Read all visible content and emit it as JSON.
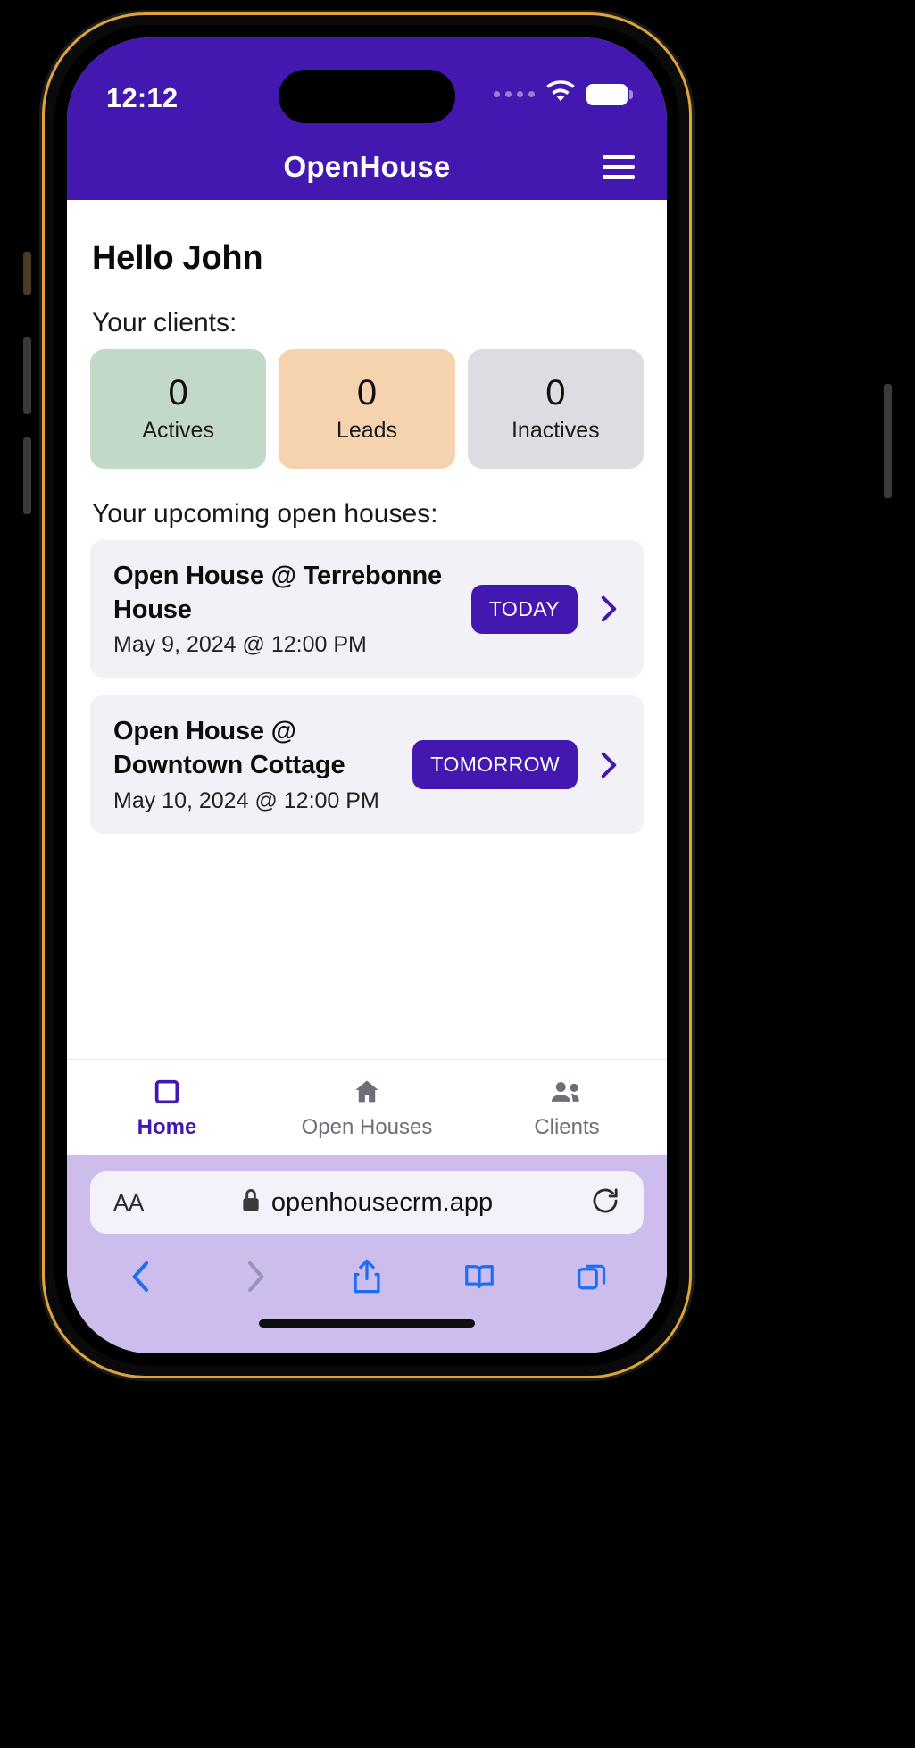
{
  "status_bar": {
    "time": "12:12",
    "signal_icon": "signal-dots-icon",
    "wifi_icon": "wifi-icon",
    "battery_icon": "battery-full-icon"
  },
  "app_header": {
    "title": "OpenHouse",
    "menu_icon": "hamburger-menu-icon"
  },
  "main": {
    "greeting": "Hello John",
    "clients_label": "Your clients:",
    "client_stats": [
      {
        "count": "0",
        "label": "Actives",
        "color": "#c1d9c6"
      },
      {
        "count": "0",
        "label": "Leads",
        "color": "#f4d3ae"
      },
      {
        "count": "0",
        "label": "Inactives",
        "color": "#dedce2"
      }
    ],
    "open_houses_label": "Your upcoming open houses:",
    "open_houses": [
      {
        "title": "Open House @ Terrebonne House",
        "date": "May 9, 2024 @ 12:00 PM",
        "badge": "TODAY",
        "chevron_icon": "chevron-right-icon"
      },
      {
        "title": "Open House @ Downtown Cottage",
        "date": "May 10, 2024 @ 12:00 PM",
        "badge": "TOMORROW",
        "chevron_icon": "chevron-right-icon"
      }
    ]
  },
  "tab_bar": [
    {
      "label": "Home",
      "icon": "square-outline-icon",
      "active": true
    },
    {
      "label": "Open Houses",
      "icon": "house-icon",
      "active": false
    },
    {
      "label": "Clients",
      "icon": "people-group-icon",
      "active": false
    }
  ],
  "browser": {
    "text_size_label": "AA",
    "lock_icon": "lock-icon",
    "url": "openhousecrm.app",
    "reload_icon": "reload-icon",
    "toolbar": [
      {
        "name": "back-button",
        "icon": "chevron-left-icon",
        "enabled": true
      },
      {
        "name": "forward-button",
        "icon": "chevron-right-icon",
        "enabled": false
      },
      {
        "name": "share-button",
        "icon": "share-icon",
        "enabled": true
      },
      {
        "name": "bookmarks-button",
        "icon": "book-icon",
        "enabled": true
      },
      {
        "name": "tabs-button",
        "icon": "tabs-icon",
        "enabled": true
      }
    ]
  },
  "theme": {
    "brand_purple": "#4318b0",
    "safari_chrome": "#cdbdec",
    "card_bg": "#f2f1f8",
    "safari_blue": "#1a6dfa"
  }
}
